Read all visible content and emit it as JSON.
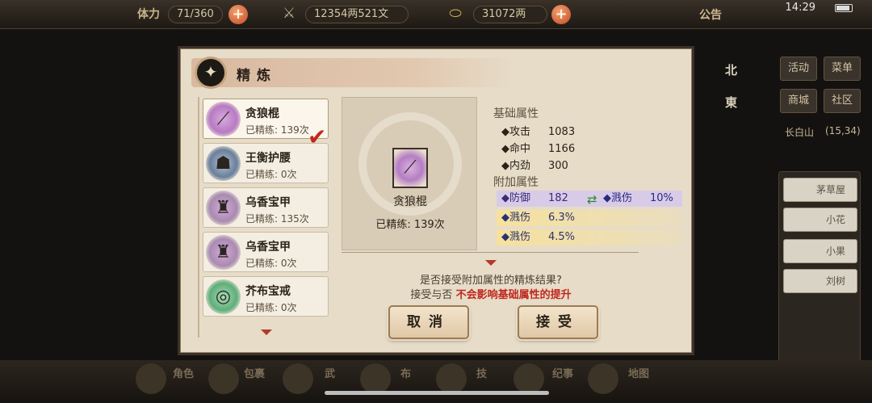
{
  "hud": {
    "stamina_label": "体力",
    "stamina_value": "71/360",
    "copper_value": "12354两521文",
    "silver_value": "31072两",
    "notice_label": "公告",
    "clock": "14:29"
  },
  "side": {
    "buttons": [
      "活动",
      "菜单",
      "商城",
      "社区"
    ],
    "compass": [
      "北",
      "東"
    ],
    "location": "长白山",
    "coords": "(15,34)",
    "npcs": [
      "茅草屋",
      "小花",
      "小果",
      "刘树"
    ]
  },
  "bottom": {
    "items": [
      "角色",
      "包裹",
      "武",
      "布",
      "技",
      "纪事",
      "地图"
    ]
  },
  "dialog": {
    "title": "精炼",
    "items": [
      {
        "name": "贪狼棍",
        "count": "已精练: 139次",
        "icon": "staff-icon"
      },
      {
        "name": "王衡护腰",
        "count": "已精练: 0次",
        "icon": "belt-icon"
      },
      {
        "name": "乌香宝甲",
        "count": "已精练: 135次",
        "icon": "armor-icon"
      },
      {
        "name": "乌香宝甲",
        "count": "已精练: 0次",
        "icon": "armor-icon"
      },
      {
        "name": "芥布宝戒",
        "count": "已精练: 0次",
        "icon": "ring-icon"
      }
    ],
    "detail": {
      "name": "贪狼棍",
      "count": "已精练: 139次"
    },
    "base_header": "基础属性",
    "base_stats": [
      {
        "label": "◆攻击",
        "value": "1083"
      },
      {
        "label": "◆命中",
        "value": "1166"
      },
      {
        "label": "◆内劲",
        "value": "300"
      }
    ],
    "extra_header": "附加属性",
    "extra_stats": [
      {
        "label": "◆防御",
        "value": "182",
        "new_label": "◆溅伤",
        "new_value": "10%"
      },
      {
        "label": "◆溅伤",
        "value": "6.3%"
      },
      {
        "label": "◆溅伤",
        "value": "4.5%"
      }
    ],
    "prompt_line1": "是否接受附加属性的精炼结果?",
    "prompt_line2_a": "接受与否",
    "prompt_line2_b": "不会影响基础属性的提升",
    "cancel_label": "取消",
    "accept_label": "接受"
  }
}
